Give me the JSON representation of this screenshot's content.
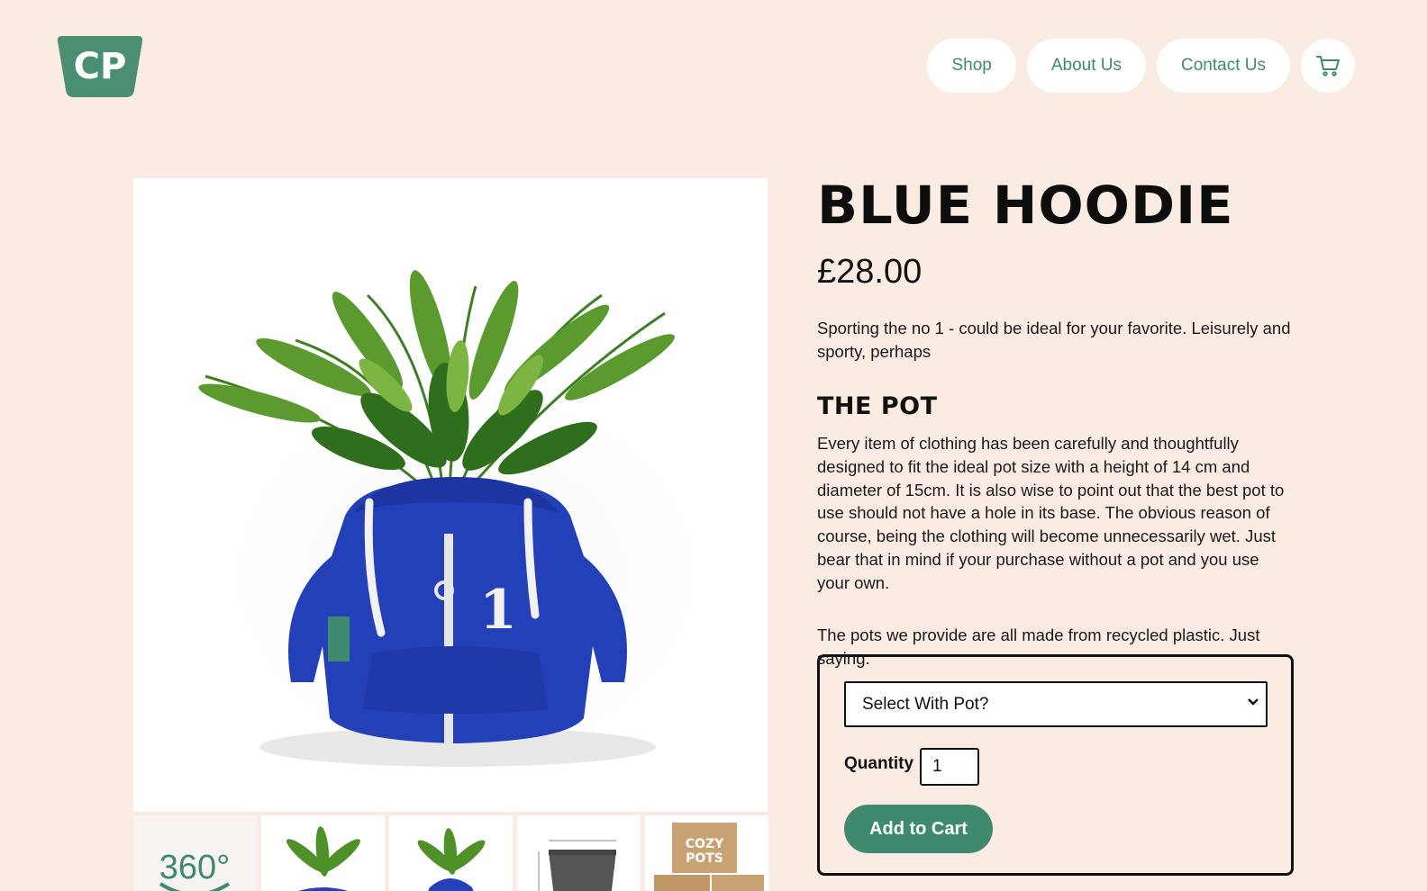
{
  "brand": {
    "logo_text": "CP",
    "color": "#4a8f72"
  },
  "nav": {
    "items": [
      {
        "label": "Shop"
      },
      {
        "label": "About Us"
      },
      {
        "label": "Contact Us"
      }
    ],
    "cart_icon": "cart-icon"
  },
  "gallery": {
    "thumbnails": [
      {
        "label": "360°"
      },
      {
        "label": ""
      },
      {
        "label": ""
      },
      {
        "label": ""
      },
      {
        "label": ""
      }
    ]
  },
  "product": {
    "title": "BLUE HOODIE",
    "price": "£28.00",
    "description": "Sporting the no 1 - could be ideal for your favorite. Leisurely and sporty, perhaps",
    "section_heading": "THE POT",
    "pot_text": "Every item of clothing has been carefully and thoughtfully designed to fit the ideal pot size with a height of 14 cm and diameter of 15cm. It is also wise to point out that the best pot to use should not have a hole in its base. The obvious reason of course, being the clothing will become unnecessarily wet. Just bear that in mind if your purchase without a pot and you use your own.",
    "note": "The pots we provide are all made from recycled plastic. Just saying."
  },
  "purchase": {
    "select_value": "Select With Pot?",
    "quantity_label": "Quantity",
    "quantity_value": "1",
    "add_button": "Add to Cart"
  },
  "colors": {
    "accent": "#3f8a6e",
    "background": "#faece3",
    "hoodie": "#2340b8"
  }
}
